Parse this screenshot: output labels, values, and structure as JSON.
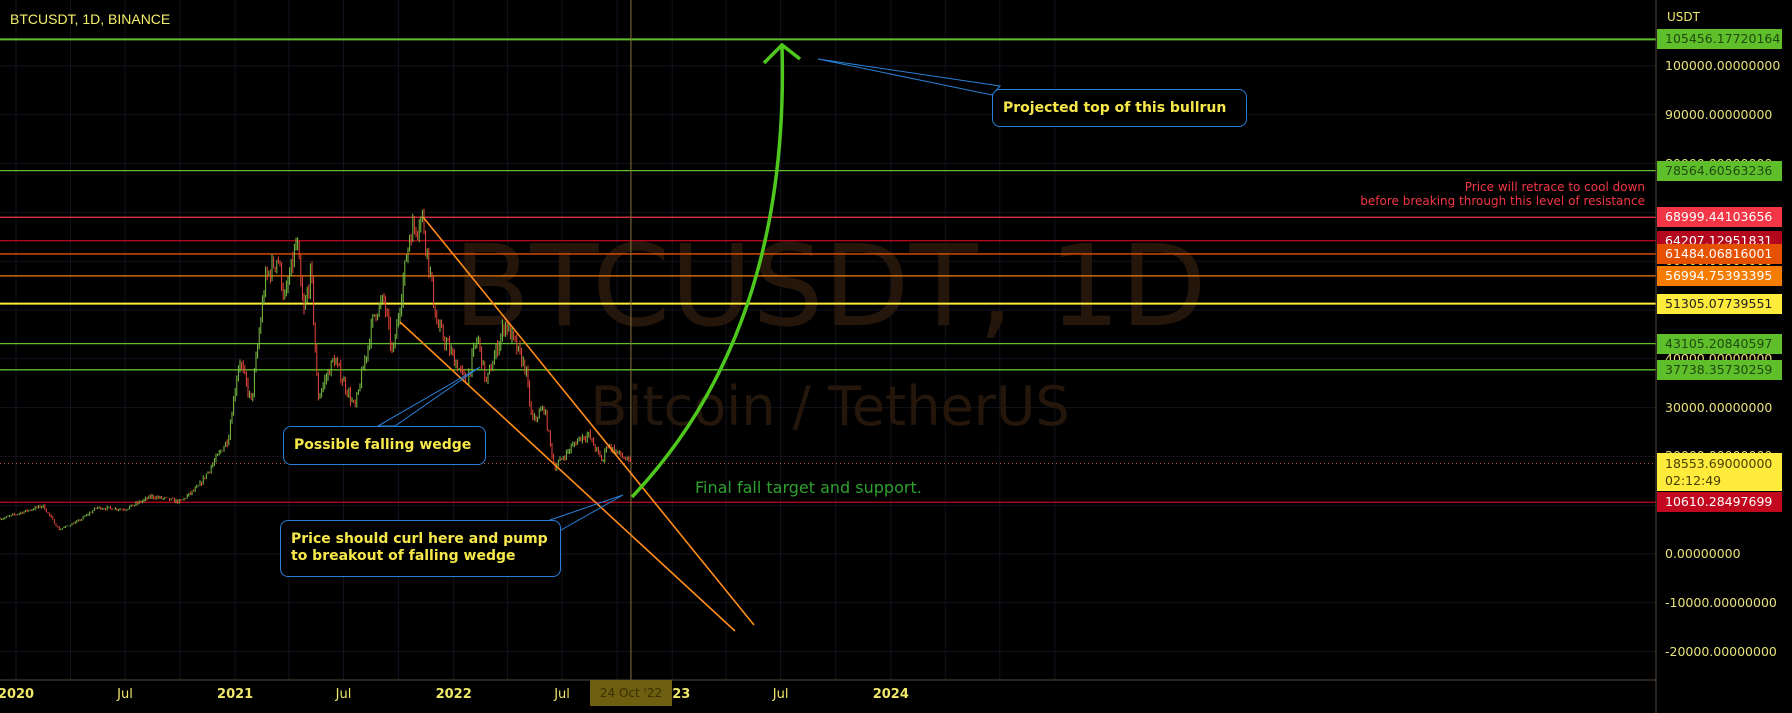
{
  "header": {
    "title": "BTCUSDT, 1D, BINANCE"
  },
  "watermark": {
    "symbol": "BTCUSDT, 1D",
    "name": "Bitcoin / TetherUS"
  },
  "chart_data": {
    "type": "candlestick",
    "symbol": "BTCUSDT",
    "interval": "1D",
    "exchange": "BINANCE",
    "currency": "USDT",
    "ylim": [
      -25000,
      113000
    ],
    "y_ticks": [
      100000,
      90000,
      80000,
      70000,
      60000,
      50000,
      40000,
      30000,
      20000,
      10000,
      0,
      -10000,
      -20000
    ],
    "y_tick_labels": [
      "100000.00000000",
      "90000.00000000",
      "80000.00000000",
      "70000.00000000",
      "60000.00000000",
      "50000.00000000",
      "40000.00000000",
      "30000.00000000",
      "20000.00000000",
      "10000.00000000",
      "0.00000000",
      "-10000.00000000",
      "-20000.00000000"
    ],
    "x_ticks": [
      {
        "date": "2020-01-01",
        "label": "2020"
      },
      {
        "date": "2020-07-01",
        "label": "Jul"
      },
      {
        "date": "2021-01-01",
        "label": "2021"
      },
      {
        "date": "2021-07-01",
        "label": "Jul"
      },
      {
        "date": "2022-01-01",
        "label": "2022"
      },
      {
        "date": "2022-07-01",
        "label": "Jul"
      },
      {
        "date": "2023-01-01",
        "label": "2023"
      },
      {
        "date": "2023-07-01",
        "label": "Jul"
      },
      {
        "date": "2024-01-01",
        "label": "2024"
      }
    ],
    "price_path": [
      [
        "2019-12-10",
        7300
      ],
      [
        "2020-01-15",
        8700
      ],
      [
        "2020-02-15",
        9900
      ],
      [
        "2020-03-13",
        5000
      ],
      [
        "2020-04-15",
        6800
      ],
      [
        "2020-05-15",
        9500
      ],
      [
        "2020-07-01",
        9200
      ],
      [
        "2020-08-15",
        11800
      ],
      [
        "2020-10-01",
        10700
      ],
      [
        "2020-11-01",
        13800
      ],
      [
        "2020-11-25",
        18500
      ],
      [
        "2020-12-20",
        23500
      ],
      [
        "2021-01-08",
        40000
      ],
      [
        "2021-01-28",
        31000
      ],
      [
        "2021-02-20",
        56000
      ],
      [
        "2021-03-13",
        61000
      ],
      [
        "2021-03-25",
        52000
      ],
      [
        "2021-04-14",
        64000
      ],
      [
        "2021-04-25",
        49000
      ],
      [
        "2021-05-08",
        58000
      ],
      [
        "2021-05-19",
        32000
      ],
      [
        "2021-06-15",
        40000
      ],
      [
        "2021-07-20",
        29800
      ],
      [
        "2021-08-22",
        49500
      ],
      [
        "2021-09-07",
        52000
      ],
      [
        "2021-09-21",
        40500
      ],
      [
        "2021-10-20",
        66000
      ],
      [
        "2021-11-10",
        69000
      ],
      [
        "2021-12-04",
        47000
      ],
      [
        "2022-01-22",
        35000
      ],
      [
        "2022-02-10",
        44500
      ],
      [
        "2022-02-24",
        35000
      ],
      [
        "2022-03-28",
        47500
      ],
      [
        "2022-05-01",
        38000
      ],
      [
        "2022-05-12",
        27000
      ],
      [
        "2022-06-01",
        30000
      ],
      [
        "2022-06-18",
        17700
      ],
      [
        "2022-07-30",
        23800
      ],
      [
        "2022-08-14",
        24400
      ],
      [
        "2022-09-07",
        18800
      ],
      [
        "2022-09-13",
        22500
      ],
      [
        "2022-10-24",
        18553.69
      ]
    ],
    "current_price": {
      "value": 18553.69,
      "label": "18553.69000000",
      "countdown": "02:12:49",
      "color": "#ffeb3b"
    },
    "cursor": {
      "date": "2022-10-24",
      "label": "24 Oct '22"
    },
    "levels": [
      {
        "value": 105456.17720164,
        "label": "105456.17720164",
        "color": "#5fbf2b",
        "text": "#1f4a10"
      },
      {
        "value": 78564.60563236,
        "label": "78564.60563236",
        "color": "#5fbf2b",
        "text": "#1f4a10"
      },
      {
        "value": 68999.44103656,
        "label": "68999.44103656",
        "color": "#f23645",
        "text": "#ffffff"
      },
      {
        "value": 64207.12951831,
        "label": "64207.12951831",
        "color": "#b2071d",
        "text": "#ffffff"
      },
      {
        "value": 61484.06816001,
        "label": "61484.06816001",
        "color": "#e65100",
        "text": "#ffffff"
      },
      {
        "value": 56994.75393395,
        "label": "56994.75393395",
        "color": "#f57c00",
        "text": "#ffffff"
      },
      {
        "value": 51305.07739551,
        "label": "51305.07739551",
        "color": "#ffeb3b",
        "text": "#222222"
      },
      {
        "value": 43105.20840597,
        "label": "43105.20840597",
        "color": "#5fbf2b",
        "text": "#1f4a10"
      },
      {
        "value": 37738.35730259,
        "label": "37738.35730259",
        "color": "#5fbf2b",
        "text": "#1f4a10"
      },
      {
        "value": 10610.28497699,
        "label": "10610.28497699",
        "color": "#c2081e",
        "text": "#ffffff"
      }
    ],
    "annotations": {
      "projected_top": "Projected top of this bullrun",
      "falling_wedge": "Possible falling wedge",
      "curl_line1": "Price should curl here and pump",
      "curl_line2": "to breakout of falling wedge",
      "final_target": "Final fall target and support.",
      "retrace_line1": "Price will retrace to cool down",
      "retrace_line2": "before breaking through this level of resistance"
    },
    "colors": {
      "up": "#7bc043",
      "down": "#e8473a",
      "wedge": "#ff8c1a",
      "arrow": "#4fc81e",
      "callout_border": "#2a7fd4"
    }
  }
}
